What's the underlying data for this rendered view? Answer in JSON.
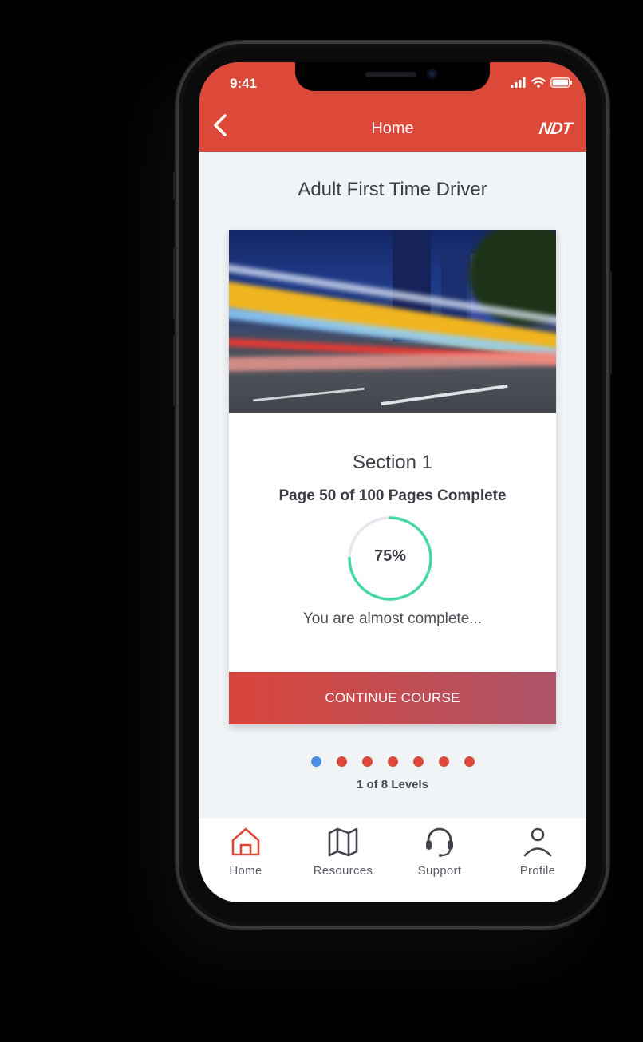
{
  "status_bar": {
    "time": "9:41"
  },
  "header": {
    "title": "Home",
    "logo": "NDT",
    "back_icon": "chevron-left-icon"
  },
  "course": {
    "title": "Adult First Time Driver"
  },
  "card": {
    "image_alt": "City night road with light trails",
    "section": "Section 1",
    "pages_text": "Page 50 of 100 Pages Complete",
    "progress_label": "75%",
    "progress_value": 0.75,
    "message": "You are almost complete...",
    "continue_label": "CONTINUE COURSE"
  },
  "levels": {
    "text": "1 of 8 Levels",
    "dots": 7,
    "active_index": 0
  },
  "tabs": [
    {
      "label": "Home",
      "icon": "home-icon",
      "active": true
    },
    {
      "label": "Resources",
      "icon": "map-icon",
      "active": false
    },
    {
      "label": "Support",
      "icon": "headset-icon",
      "active": false
    },
    {
      "label": "Profile",
      "icon": "user-icon",
      "active": false
    }
  ],
  "colors": {
    "brand": "#dc4939",
    "progress": "#47d6a8",
    "active_dot": "#4a8ee6",
    "bg": "#f1f4f7"
  }
}
